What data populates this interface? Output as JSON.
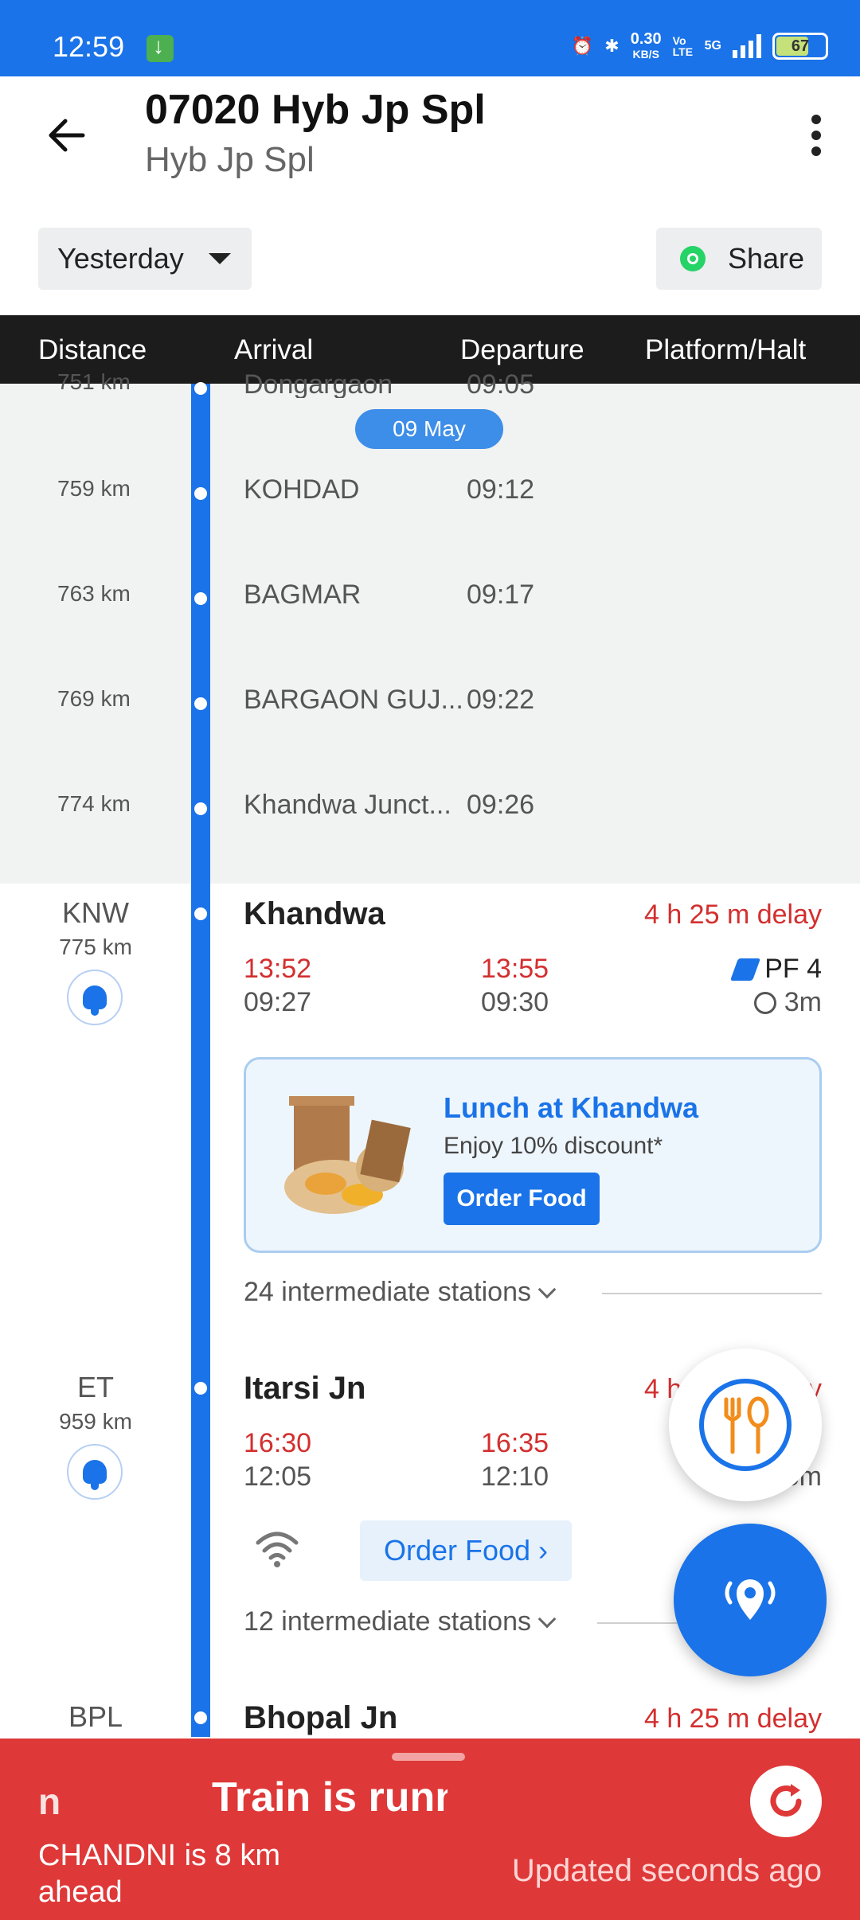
{
  "status_bar": {
    "time": "12:59",
    "net_speed": "0.30",
    "net_unit": "KB/S",
    "volte": "Vo LTE",
    "network": "5G",
    "battery": "67"
  },
  "header": {
    "title": "07020 Hyb Jp Spl",
    "subtitle": "Hyb Jp Spl",
    "date_select": "Yesterday",
    "share_label": "Share"
  },
  "columns": {
    "distance": "Distance",
    "arrival": "Arrival",
    "departure": "Departure",
    "platform": "Platform/Halt"
  },
  "date_pill": "09 May",
  "gray_rows": [
    {
      "km": "751 km",
      "name": "Dongargaon",
      "time": "09:05"
    },
    {
      "km": "759 km",
      "name": "KOHDAD",
      "time": "09:12"
    },
    {
      "km": "763 km",
      "name": "BAGMAR",
      "time": "09:17"
    },
    {
      "km": "769 km",
      "name": "BARGAON GUJ...",
      "time": "09:22"
    },
    {
      "km": "774 km",
      "name": "Khandwa Junct...",
      "time": "09:26"
    }
  ],
  "stations": [
    {
      "code": "KNW",
      "km": "775 km",
      "name": "Khandwa",
      "delay": "4 h 25 m delay",
      "arr_actual": "13:52",
      "arr_sched": "09:27",
      "dep_actual": "13:55",
      "dep_sched": "09:30",
      "platform": "PF 4",
      "halt": "3m",
      "intermediate": "24 intermediate stations"
    },
    {
      "code": "ET",
      "km": "959 km",
      "name": "Itarsi Jn",
      "delay": "4 h 25 m delay",
      "arr_actual": "16:30",
      "arr_sched": "12:05",
      "dep_actual": "16:35",
      "dep_sched": "12:10",
      "halt": "5m",
      "order_food": "Order Food ›",
      "intermediate": "12 intermediate stations"
    },
    {
      "code": "BPL",
      "name": "Bhopal  Jn",
      "delay": "4 h 25 m delay"
    }
  ],
  "food_card": {
    "title": "Lunch at Khandwa",
    "subtitle": "Enjoy 10% discount*",
    "button": "Order Food"
  },
  "bottom_sheet": {
    "marquee_left": "n",
    "marquee_main": "Train is running",
    "ahead": "CHANDNI is 8 km ahead",
    "updated": "Updated seconds  ago"
  },
  "colors": {
    "primary": "#1a73e8",
    "delay_red": "#d32f2f",
    "banner_red": "#df3838"
  }
}
